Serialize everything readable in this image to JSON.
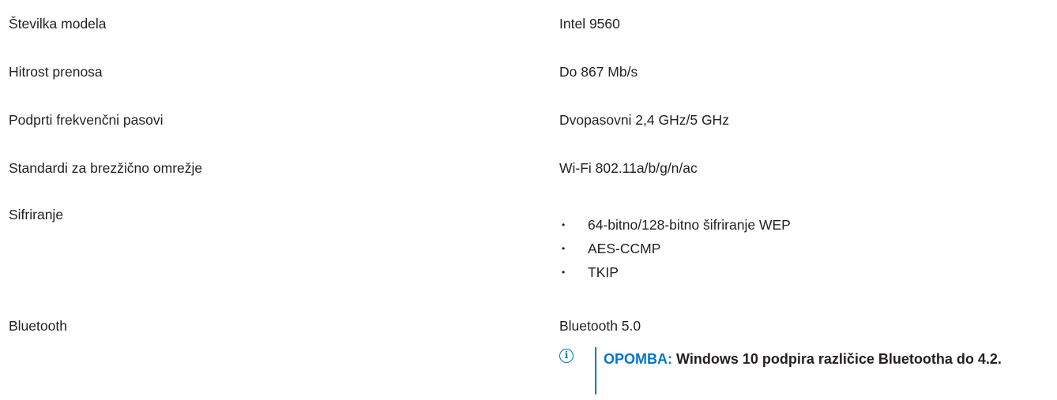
{
  "specs": [
    {
      "label": "Številka modela",
      "value": "Intel 9560"
    },
    {
      "label": "Hitrost prenosa",
      "value": "Do 867 Mb/s"
    },
    {
      "label": "Podprti frekvenčni pasovi",
      "value": "Dvopasovni 2,4 GHz/5 GHz"
    },
    {
      "label": "Standardi za brezžično omrežje",
      "value": "Wi-Fi 802.11a/b/g/n/ac"
    },
    {
      "label": "Sifriranje",
      "bullets": [
        "64-bitno/128-bitno šifriranje WEP",
        "AES-CCMP",
        "TKIP"
      ]
    },
    {
      "label": "Bluetooth",
      "value": "Bluetooth 5.0"
    }
  ],
  "note": {
    "icon": "info-icon",
    "icon_glyph": "i",
    "label": "OPOMBA:",
    "text": "Windows 10 podpira različice Bluetootha do 4.2.",
    "accent_color": "#0076ce"
  },
  "bullet_glyph": "•"
}
